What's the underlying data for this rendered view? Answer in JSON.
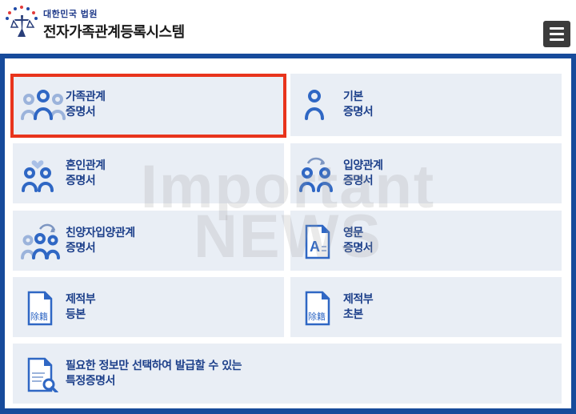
{
  "header": {
    "org_sub": "대한민국 법원",
    "org_title": "전자가족관계등록시스템",
    "menu_icon": "hamburger-menu-icon"
  },
  "watermark": {
    "line1": "Important",
    "line2": "NEWS"
  },
  "colors": {
    "frame": "#174b9b",
    "card_bg": "#e9eef5",
    "label": "#1c3f8a",
    "highlight": "#e8341c",
    "menu": "#3b3b3b"
  },
  "cards": [
    {
      "line1": "가족관계",
      "line2": "증명서",
      "icon": "family-icon"
    },
    {
      "line1": "기본",
      "line2": "증명서",
      "icon": "person-icon"
    },
    {
      "line1": "혼인관계",
      "line2": "증명서",
      "icon": "marriage-icon"
    },
    {
      "line1": "입양관계",
      "line2": "증명서",
      "icon": "adoption-icon"
    },
    {
      "line1": "친양자입양관계",
      "line2": "증명서",
      "icon": "full-adoption-icon"
    },
    {
      "line1": "영문",
      "line2": "증명서",
      "icon": "english-document-icon"
    },
    {
      "line1": "제적부",
      "line2": "등본",
      "icon": "removed-register-document-icon",
      "stamp": "除籍"
    },
    {
      "line1": "제적부",
      "line2": "초본",
      "icon": "removed-register-document-icon",
      "stamp": "除籍"
    },
    {
      "line1": "필요한 정보만 선택하여 발급할 수 있는",
      "line2": "특정증명서",
      "icon": "document-search-icon"
    }
  ]
}
